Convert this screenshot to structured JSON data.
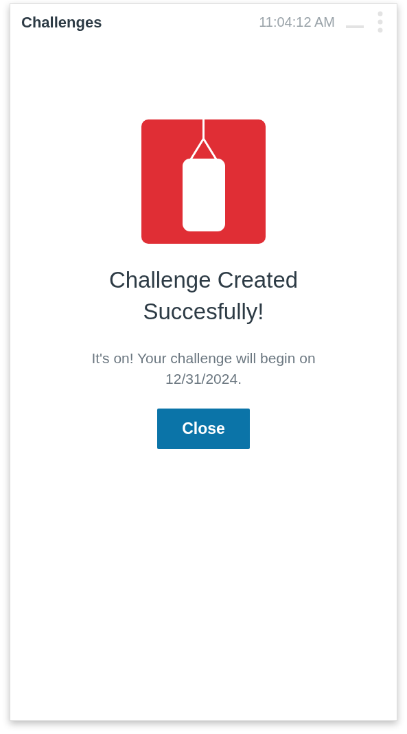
{
  "header": {
    "title": "Challenges",
    "time": "11:04:12 AM"
  },
  "dialog": {
    "title": "Challenge Created Succesfully!",
    "message": "It's on! Your challenge will begin on 12/31/2024.",
    "button": "Close"
  }
}
